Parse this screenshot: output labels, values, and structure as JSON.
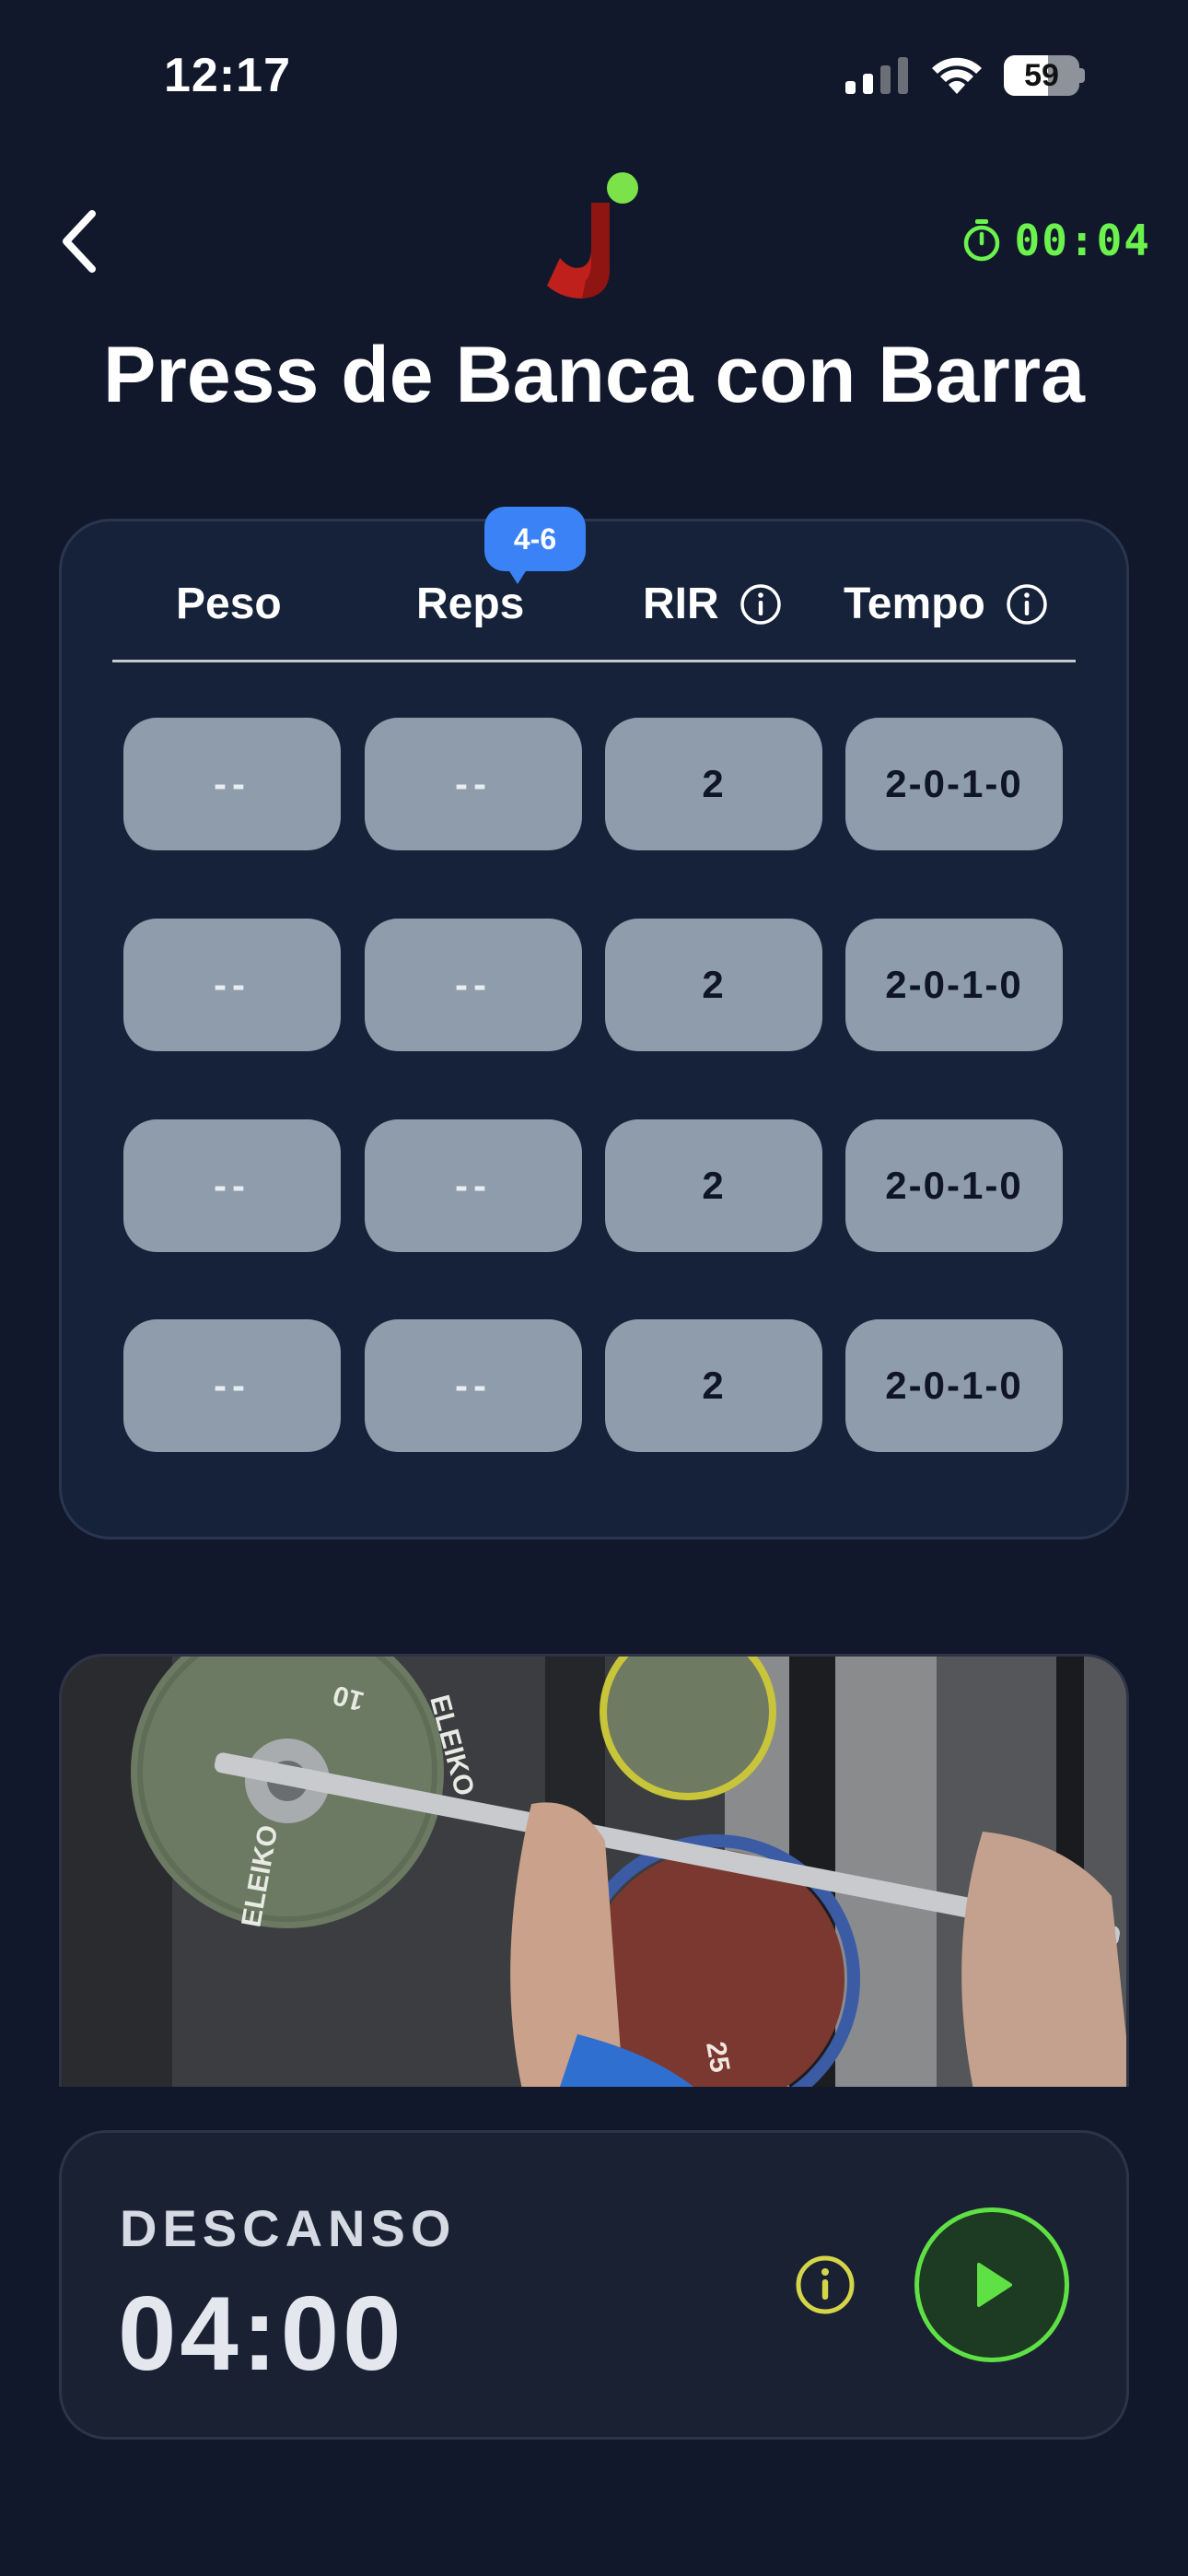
{
  "status_bar": {
    "time": "12:17",
    "battery_level": "59",
    "battery_fraction": 0.59
  },
  "header": {
    "title": "Press de Banca con Barra",
    "timer": "00:04",
    "accent_color": "#6cf24d"
  },
  "sets_table": {
    "reps_badge": "4-6",
    "columns": {
      "peso": "Peso",
      "reps": "Reps",
      "rir": "RIR",
      "tempo": "Tempo"
    },
    "rows": [
      {
        "peso": "--",
        "reps": "--",
        "rir": "2",
        "tempo": "2-0-1-0"
      },
      {
        "peso": "--",
        "reps": "--",
        "rir": "2",
        "tempo": "2-0-1-0"
      },
      {
        "peso": "--",
        "reps": "--",
        "rir": "2",
        "tempo": "2-0-1-0"
      },
      {
        "peso": "--",
        "reps": "--",
        "rir": "2",
        "tempo": "2-0-1-0"
      }
    ]
  },
  "video": {
    "plate_brand": "ELEIKO",
    "plate_weight_left": "10",
    "plate_weight_red": "25"
  },
  "rest": {
    "label": "DESCANSO",
    "time": "04:00",
    "play_color": "#5fe145",
    "info_color": "#d4d648"
  },
  "icons": [
    "chevron-left-icon",
    "stopwatch-icon",
    "info-icon",
    "play-icon",
    "signal-icon",
    "wifi-icon",
    "battery-icon"
  ]
}
